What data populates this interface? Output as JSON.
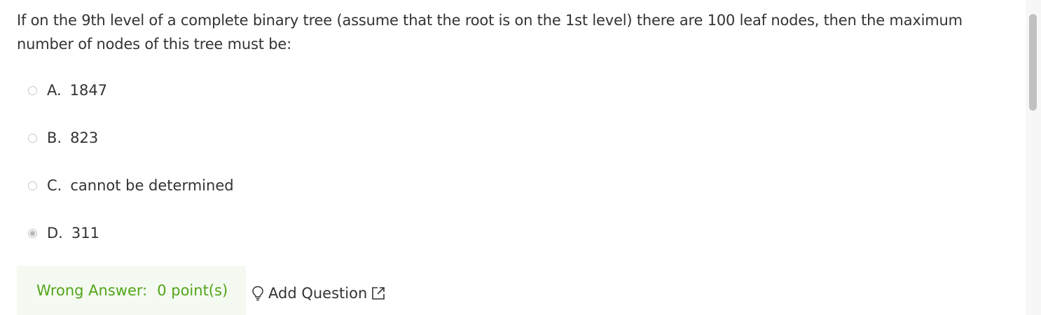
{
  "question": {
    "text": "If on the 9th level of a complete binary tree (assume that the root is on the 1st level) there are 100 leaf nodes, then the maximum number of nodes of this tree must be:"
  },
  "options": [
    {
      "letter": "A.",
      "text": "1847",
      "selected": false
    },
    {
      "letter": "B.",
      "text": "823",
      "selected": false
    },
    {
      "letter": "C.",
      "text": "cannot be determined",
      "selected": false
    },
    {
      "letter": "D.",
      "text": "311",
      "selected": true
    }
  ],
  "result": {
    "label": "Wrong Answer:",
    "points": "0 point(s)",
    "color": "#52a41a",
    "background": "#f4faf1"
  },
  "add_question": {
    "label": "Add Question",
    "icon_left": "lightbulb-icon",
    "icon_right": "external-link-icon"
  }
}
